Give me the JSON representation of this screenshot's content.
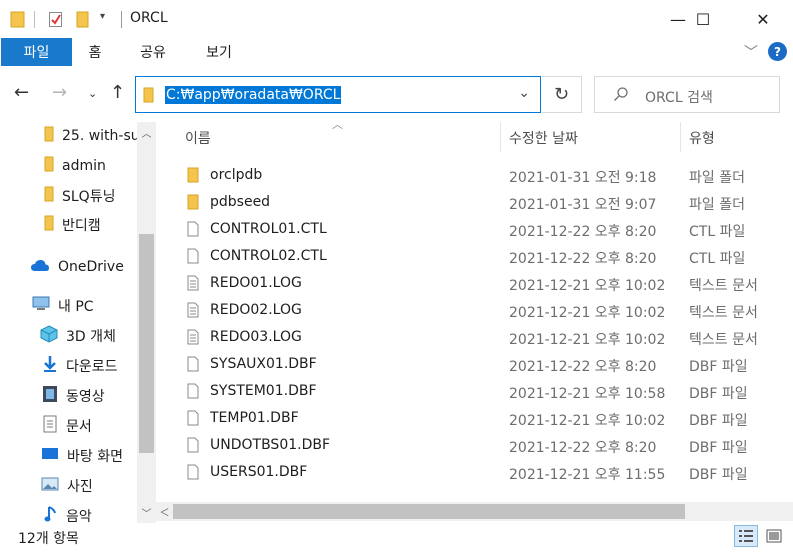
{
  "window": {
    "title": "ORCL",
    "minimize_glyph": "—",
    "maximize_glyph": "☐",
    "close_glyph": "✕"
  },
  "ribbon": {
    "tabs": [
      {
        "label": "파일",
        "active": true
      },
      {
        "label": "홈",
        "active": false
      },
      {
        "label": "공유",
        "active": false
      },
      {
        "label": "보기",
        "active": false
      }
    ],
    "help_label": "?"
  },
  "address": {
    "path": "C:₩app₩oradata₩ORCL",
    "search_placeholder": "ORCL 검색"
  },
  "sidebar": {
    "items": [
      {
        "label": "25. with-su",
        "icon": "folder-icon"
      },
      {
        "label": "admin",
        "icon": "folder-icon"
      },
      {
        "label": "SLQ튜닝",
        "icon": "folder-icon"
      },
      {
        "label": "반디캠",
        "icon": "folder-icon"
      },
      {
        "label": "OneDrive",
        "icon": "onedrive-icon"
      },
      {
        "label": "내 PC",
        "icon": "pc-icon"
      },
      {
        "label": "3D 개체",
        "icon": "3d-objects-icon"
      },
      {
        "label": "다운로드",
        "icon": "download-icon"
      },
      {
        "label": "동영상",
        "icon": "video-icon"
      },
      {
        "label": "문서",
        "icon": "document-icon"
      },
      {
        "label": "바탕 화면",
        "icon": "desktop-icon"
      },
      {
        "label": "사진",
        "icon": "pictures-icon"
      },
      {
        "label": "음악",
        "icon": "music-icon"
      }
    ]
  },
  "columns": {
    "name": "이름",
    "date": "수정한 날짜",
    "type": "유형"
  },
  "files": [
    {
      "name": "orclpdb",
      "date": "2021-01-31 오전 9:18",
      "type": "파일 폴더",
      "icon": "folder-icon"
    },
    {
      "name": "pdbseed",
      "date": "2021-01-31 오전 9:07",
      "type": "파일 폴더",
      "icon": "folder-icon"
    },
    {
      "name": "CONTROL01.CTL",
      "date": "2021-12-22 오후 8:20",
      "type": "CTL 파일",
      "icon": "file-icon"
    },
    {
      "name": "CONTROL02.CTL",
      "date": "2021-12-22 오후 8:20",
      "type": "CTL 파일",
      "icon": "file-icon"
    },
    {
      "name": "REDO01.LOG",
      "date": "2021-12-21 오후 10:02",
      "type": "텍스트 문서",
      "icon": "text-file-icon"
    },
    {
      "name": "REDO02.LOG",
      "date": "2021-12-21 오후 10:02",
      "type": "텍스트 문서",
      "icon": "text-file-icon"
    },
    {
      "name": "REDO03.LOG",
      "date": "2021-12-21 오후 10:02",
      "type": "텍스트 문서",
      "icon": "text-file-icon"
    },
    {
      "name": "SYSAUX01.DBF",
      "date": "2021-12-22 오후 8:20",
      "type": "DBF 파일",
      "icon": "file-icon"
    },
    {
      "name": "SYSTEM01.DBF",
      "date": "2021-12-21 오후 10:58",
      "type": "DBF 파일",
      "icon": "file-icon"
    },
    {
      "name": "TEMP01.DBF",
      "date": "2021-12-21 오후 10:02",
      "type": "DBF 파일",
      "icon": "file-icon"
    },
    {
      "name": "UNDOTBS01.DBF",
      "date": "2021-12-22 오후 8:20",
      "type": "DBF 파일",
      "icon": "file-icon"
    },
    {
      "name": "USERS01.DBF",
      "date": "2021-12-21 오후 11:55",
      "type": "DBF 파일",
      "icon": "file-icon"
    }
  ],
  "status": {
    "item_count": "12개 항목"
  },
  "colors": {
    "accent": "#0078d7",
    "ribbon_active": "#1979ca",
    "folder": "#f4c44e"
  }
}
